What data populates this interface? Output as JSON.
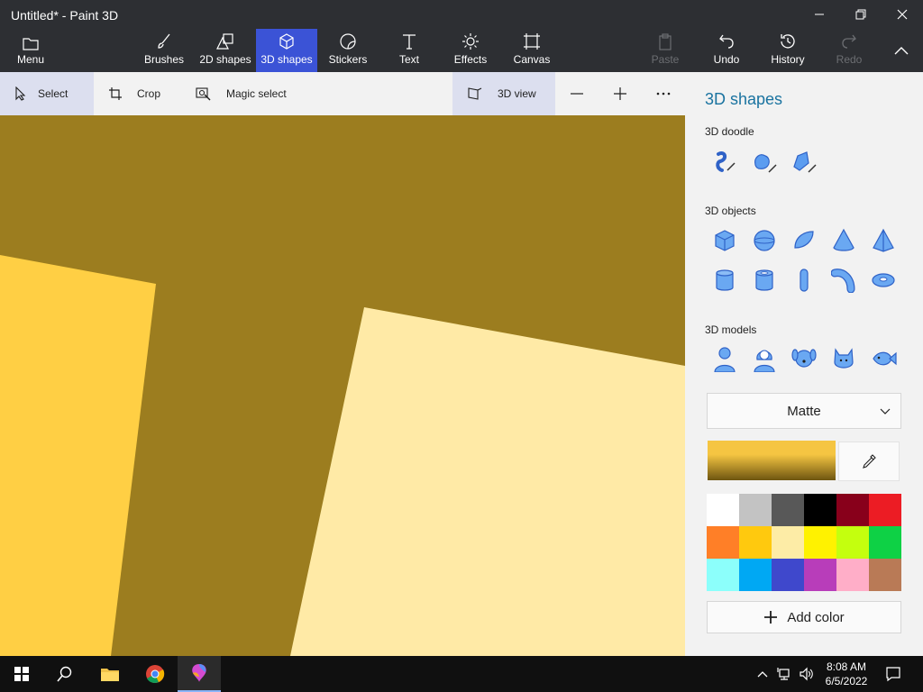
{
  "window": {
    "title": "Untitled* - Paint 3D"
  },
  "ribbon": {
    "menu": "Menu",
    "tools": [
      {
        "label": "Brushes",
        "icon": "brush-icon"
      },
      {
        "label": "2D shapes",
        "icon": "2d-shapes-icon"
      },
      {
        "label": "3D shapes",
        "icon": "3d-shapes-icon",
        "active": true
      },
      {
        "label": "Stickers",
        "icon": "stickers-icon"
      },
      {
        "label": "Text",
        "icon": "text-icon"
      },
      {
        "label": "Effects",
        "icon": "effects-icon"
      },
      {
        "label": "Canvas",
        "icon": "canvas-icon"
      }
    ],
    "paste": "Paste",
    "undo": "Undo",
    "history": "History",
    "redo": "Redo"
  },
  "toolbar": {
    "select": "Select",
    "crop": "Crop",
    "magic_select": "Magic select",
    "view_3d": "3D view"
  },
  "panel": {
    "title": "3D shapes",
    "doodle_label": "3D doodle",
    "objects_label": "3D objects",
    "models_label": "3D models",
    "material": "Matte",
    "add_color": "Add color",
    "selected_color": "#f5c542",
    "palette": [
      "#ffffff",
      "#c3c3c3",
      "#585858",
      "#000000",
      "#88001b",
      "#ec1c24",
      "#ff7f27",
      "#ffc90e",
      "#fdeca6",
      "#fff200",
      "#c4ff0e",
      "#0ed145",
      "#8cfffb",
      "#00a8f3",
      "#3f48cc",
      "#b83dba",
      "#ffaec8",
      "#b97a56"
    ]
  },
  "canvas": {
    "bg_color": "#9c7d1f",
    "left_shape_color": "#ffcf44",
    "right_shape_color": "#ffeaa6"
  },
  "taskbar": {
    "time": "8:08 AM",
    "date": "6/5/2022"
  }
}
